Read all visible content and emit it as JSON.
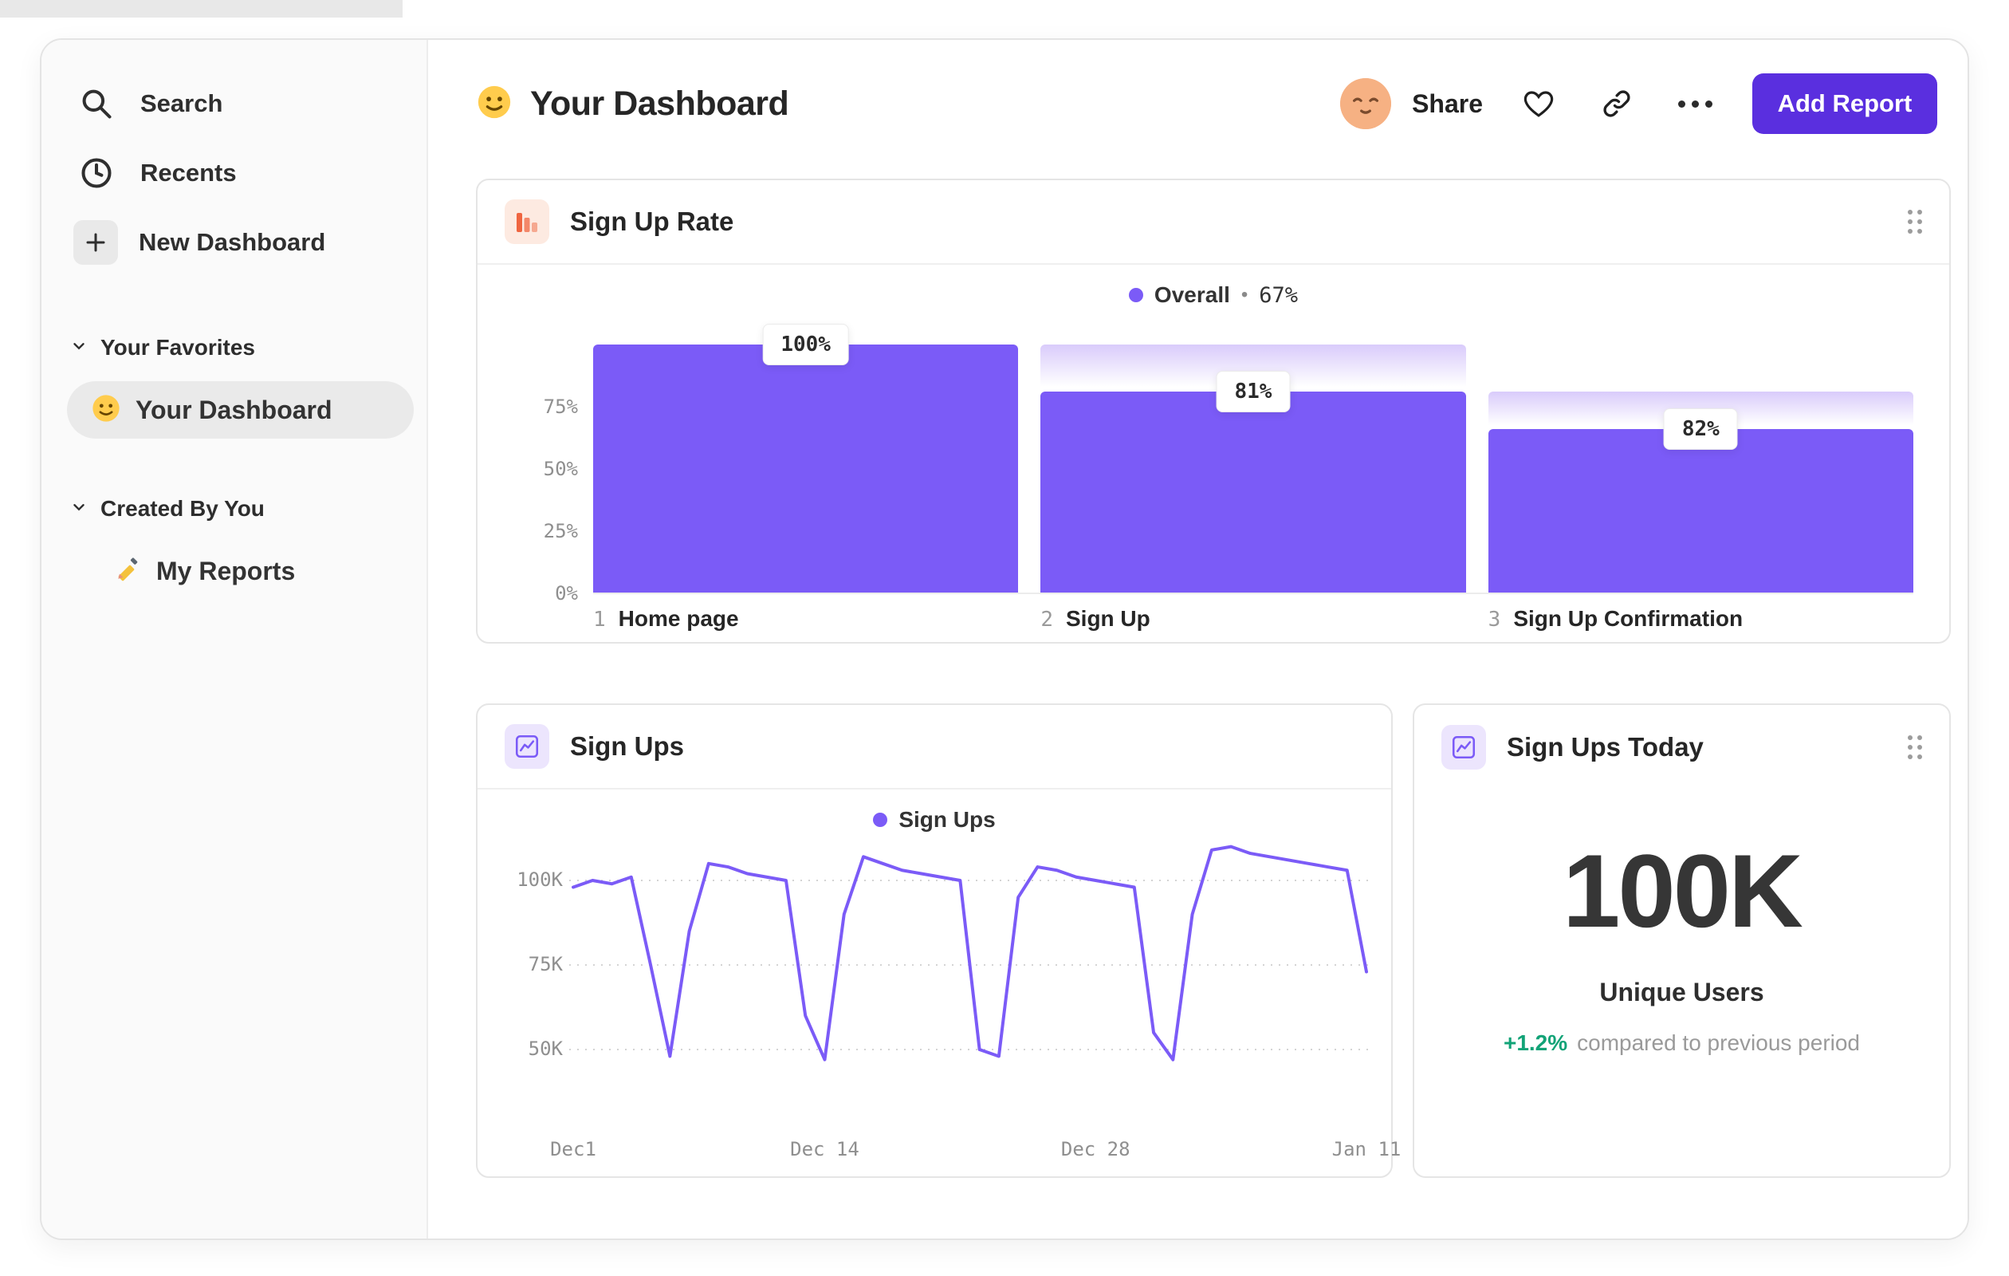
{
  "sidebar": {
    "nav": [
      {
        "label": "Search",
        "icon": "search-icon"
      },
      {
        "label": "Recents",
        "icon": "clock-icon"
      },
      {
        "label": "New Dashboard",
        "icon": "plus-icon"
      }
    ],
    "sections": [
      {
        "title": "Your Favorites",
        "items": [
          {
            "emoji": "🙂",
            "label": "Your Dashboard",
            "selected": true
          }
        ]
      },
      {
        "title": "Created By You",
        "items": [
          {
            "emoji": "✏️",
            "label": "My Reports",
            "selected": false
          }
        ]
      }
    ]
  },
  "header": {
    "emoji": "🙂",
    "title": "Your Dashboard",
    "avatar_emoji": "😌",
    "share_label": "Share",
    "add_report_label": "Add Report"
  },
  "colors": {
    "accent_purple": "#7b5bf7",
    "button_purple": "#5a2fdf",
    "icon_orange": "#ef6540",
    "delta_green": "#12a377"
  },
  "chart_data": [
    {
      "type": "bar",
      "variant": "funnel",
      "title": "Sign Up Rate",
      "legend": {
        "name": "Overall",
        "bullet": "•",
        "value": "67%"
      },
      "ylim": [
        0,
        100
      ],
      "y_ticks": [
        {
          "label": "75%",
          "value": 75
        },
        {
          "label": "50%",
          "value": 50
        },
        {
          "label": "25%",
          "value": 25
        },
        {
          "label": "0%",
          "value": 0
        }
      ],
      "steps": [
        {
          "index": "1",
          "label": "Home page",
          "badge": "100%",
          "height_pct": 100,
          "prev_pct": 100
        },
        {
          "index": "2",
          "label": "Sign Up",
          "badge": "81%",
          "height_pct": 81,
          "prev_pct": 100
        },
        {
          "index": "3",
          "label": "Sign Up Confirmation",
          "badge": "82%",
          "height_pct": 66,
          "prev_pct": 81
        }
      ]
    },
    {
      "type": "line",
      "title": "Sign Ups",
      "legend": {
        "name": "Sign Ups"
      },
      "unit": "K",
      "ylim": [
        40,
        115
      ],
      "y_ticks": [
        {
          "label": "100K",
          "value": 100
        },
        {
          "label": "75K",
          "value": 75
        },
        {
          "label": "50K",
          "value": 50
        }
      ],
      "x_ticks": [
        {
          "label": "Dec1",
          "day": 0
        },
        {
          "label": "Dec 14",
          "day": 13
        },
        {
          "label": "Dec 28",
          "day": 27
        },
        {
          "label": "Jan 11",
          "day": 41
        }
      ],
      "points": [
        [
          0,
          98
        ],
        [
          1,
          100
        ],
        [
          2,
          99
        ],
        [
          3,
          101
        ],
        [
          4,
          75
        ],
        [
          5,
          48
        ],
        [
          6,
          85
        ],
        [
          7,
          105
        ],
        [
          8,
          104
        ],
        [
          9,
          102
        ],
        [
          10,
          101
        ],
        [
          11,
          100
        ],
        [
          12,
          60
        ],
        [
          13,
          47
        ],
        [
          14,
          90
        ],
        [
          15,
          107
        ],
        [
          16,
          105
        ],
        [
          17,
          103
        ],
        [
          18,
          102
        ],
        [
          19,
          101
        ],
        [
          20,
          100
        ],
        [
          21,
          50
        ],
        [
          22,
          48
        ],
        [
          23,
          95
        ],
        [
          24,
          104
        ],
        [
          25,
          103
        ],
        [
          26,
          101
        ],
        [
          27,
          100
        ],
        [
          28,
          99
        ],
        [
          29,
          98
        ],
        [
          30,
          55
        ],
        [
          31,
          47
        ],
        [
          32,
          90
        ],
        [
          33,
          109
        ],
        [
          34,
          110
        ],
        [
          35,
          108
        ],
        [
          36,
          107
        ],
        [
          37,
          106
        ],
        [
          38,
          105
        ],
        [
          39,
          104
        ],
        [
          40,
          103
        ],
        [
          41,
          73
        ]
      ]
    },
    {
      "type": "metric",
      "title": "Sign Ups Today",
      "value": "100K",
      "label": "Unique Users",
      "delta": "+1.2%",
      "delta_note": "compared to previous period"
    }
  ]
}
